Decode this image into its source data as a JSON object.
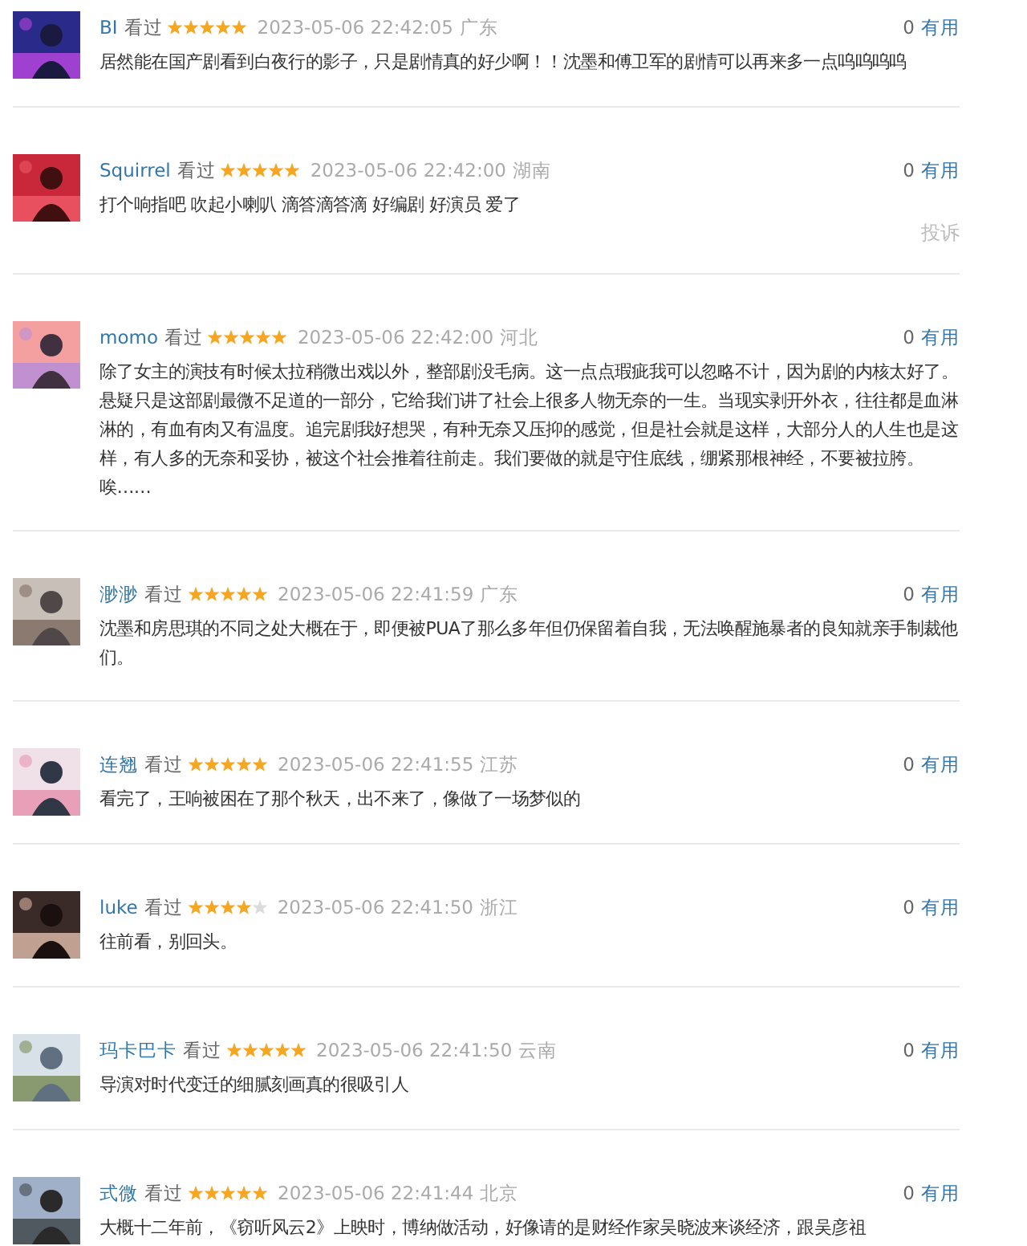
{
  "comments": [
    {
      "user": "BI",
      "status": "看过",
      "stars": 5,
      "time": "2023-05-06 22:42:05",
      "location": "广东",
      "votes": "0",
      "vote_label": "有用",
      "text": "居然能在国产剧看到白夜行的影子，只是剧情真的好少啊！！沈墨和傅卫军的剧情可以再来多一点呜呜呜呜"
    },
    {
      "user": "Squirrel",
      "status": "看过",
      "stars": 5,
      "time": "2023-05-06 22:42:00",
      "location": "湖南",
      "votes": "0",
      "vote_label": "有用",
      "text": "打个响指吧 吹起小喇叭 滴答滴答滴 好编剧 好演员 爱了",
      "report": "投诉"
    },
    {
      "user": "momo",
      "status": "看过",
      "stars": 5,
      "time": "2023-05-06 22:42:00",
      "location": "河北",
      "votes": "0",
      "vote_label": "有用",
      "text": "除了女主的演技有时候太拉稍微出戏以外，整部剧没毛病。这一点点瑕疵我可以忽略不计，因为剧的内核太好了。悬疑只是这部剧最微不足道的一部分，它给我们讲了社会上很多人物无奈的一生。当现实剥开外衣，往往都是血淋淋的，有血有肉又有温度。追完剧我好想哭，有种无奈又压抑的感觉，但是社会就是这样，大部分人的人生也是这样，有人多的无奈和妥协，被这个社会推着往前走。我们要做的就是守住底线，绷紧那根神经，不要被拉胯。唉……"
    },
    {
      "user": "渺渺",
      "status": "看过",
      "stars": 5,
      "time": "2023-05-06 22:41:59",
      "location": "广东",
      "votes": "0",
      "vote_label": "有用",
      "text": "沈墨和房思琪的不同之处大概在于，即便被PUA了那么多年但仍保留着自我，无法唤醒施暴者的良知就亲手制裁他们。"
    },
    {
      "user": "连翘",
      "status": "看过",
      "stars": 5,
      "time": "2023-05-06 22:41:55",
      "location": "江苏",
      "votes": "0",
      "vote_label": "有用",
      "text": "看完了，王响被困在了那个秋天，出不来了，像做了一场梦似的"
    },
    {
      "user": "luke",
      "status": "看过",
      "stars": 4,
      "time": "2023-05-06 22:41:50",
      "location": "浙江",
      "votes": "0",
      "vote_label": "有用",
      "text": "往前看，别回头。"
    },
    {
      "user": "玛卡巴卡",
      "status": "看过",
      "stars": 5,
      "time": "2023-05-06 22:41:50",
      "location": "云南",
      "votes": "0",
      "vote_label": "有用",
      "text": "导演对时代变迁的细腻刻画真的很吸引人"
    },
    {
      "user": "式微",
      "status": "看过",
      "stars": 5,
      "time": "2023-05-06 22:41:44",
      "location": "北京",
      "votes": "0",
      "vote_label": "有用",
      "text": "大概十二年前，《窃听风云2》上映时，博纳做活动，好像请的是财经作家吴晓波来谈经济，跟吴彦祖"
    }
  ]
}
